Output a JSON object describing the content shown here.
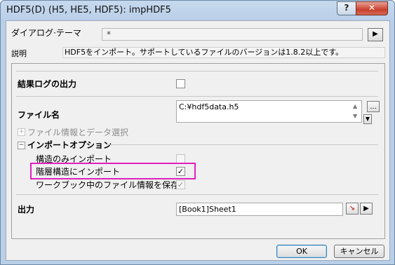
{
  "window": {
    "title": "HDF5(D) (H5, HE5, HDF5): impHDF5",
    "help_label": "?",
    "close_label": "✕"
  },
  "theme": {
    "label": "ダイアログ·テーマ",
    "value": "*",
    "arrow": "▶"
  },
  "description": {
    "label": "説明",
    "text": "HDF5をインポート。サポートしているファイルのバージョンは1.8.2以上です。"
  },
  "options": {
    "result_log": {
      "label": "結果ログの出力",
      "checked": false
    },
    "file_name": {
      "label": "ファイル名",
      "value": "C:¥hdf5data.h5",
      "browse_label": "..."
    },
    "file_info_section": {
      "expander": "⊞",
      "label": "ファイル情報とデータ選択"
    },
    "import_options_section": {
      "expander": "⊟",
      "label": "インポートオプション"
    },
    "structure_only": {
      "label": "構造のみインポート",
      "checked": false
    },
    "hierarchical": {
      "label": "階層構造にインポート",
      "checked": true,
      "tick": "✓"
    },
    "save_file_info": {
      "label": "ワークブック中のファイル情報を保存",
      "checked": true,
      "tick": "✓"
    },
    "output": {
      "label": "出力",
      "value": "[Book1]Sheet1",
      "arrow": "▶"
    }
  },
  "buttons": {
    "ok": "OK",
    "cancel": "キャンセル"
  },
  "colors": {
    "highlight": "#e020c0",
    "close": "#c8402c"
  }
}
